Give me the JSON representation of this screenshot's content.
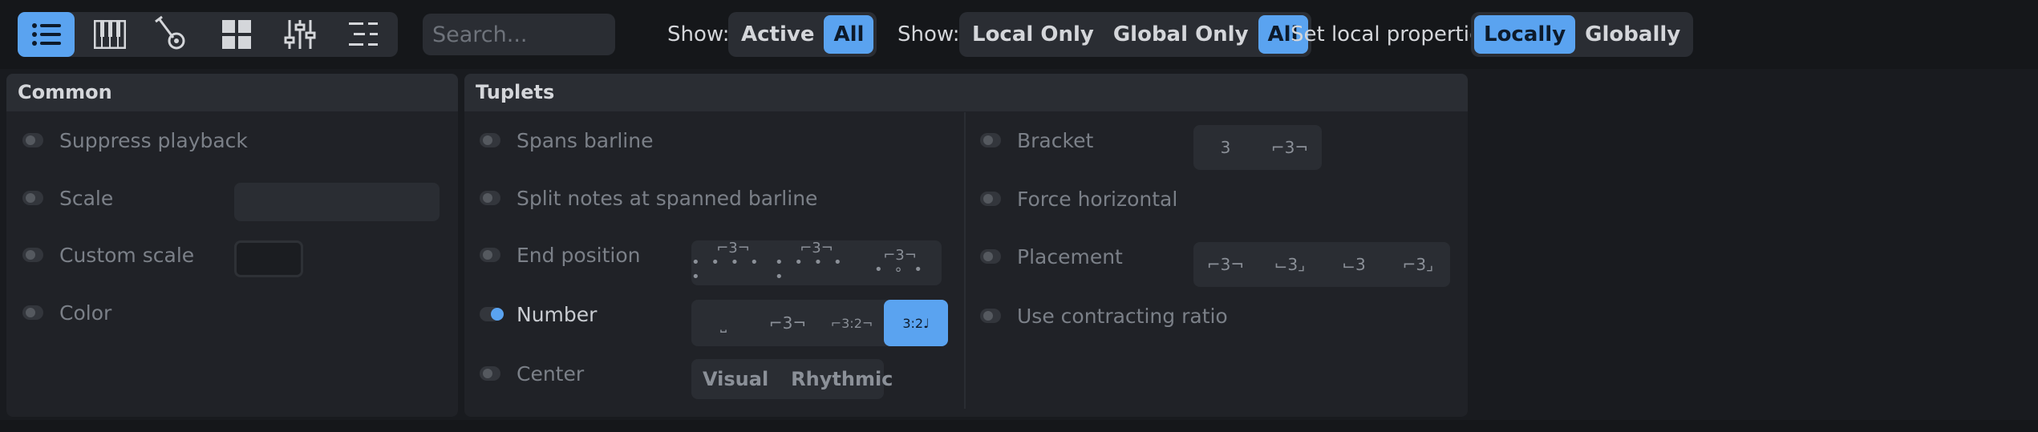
{
  "toolbar": {
    "icons": [
      "list-icon",
      "piano-icon",
      "guitar-icon",
      "grid-icon",
      "sliders-icon",
      "outline-icon"
    ],
    "search_placeholder": "Search...",
    "show1": {
      "label": "Show:",
      "options": [
        "Active",
        "All"
      ],
      "selected": "All"
    },
    "show2": {
      "label": "Show:",
      "options": [
        "Local Only",
        "Global Only",
        "All"
      ],
      "selected": "All"
    },
    "local": {
      "label": "Set local properties:",
      "options": [
        "Locally",
        "Globally"
      ],
      "selected": "Locally"
    }
  },
  "common": {
    "title": "Common",
    "rows": [
      "Suppress playback",
      "Scale",
      "Custom scale",
      "Color"
    ]
  },
  "tuplets": {
    "title": "Tuplets",
    "left_rows": [
      "Spans barline",
      "Split notes at spanned barline",
      "End position",
      "Number",
      "Center"
    ],
    "right_rows": [
      "Bracket",
      "Force horizontal",
      "Placement",
      "Use contracting ratio"
    ],
    "end_position_options": [
      "⌐3¬",
      "⌐3¬",
      "⌐3¬"
    ],
    "number_options": [
      "⎵",
      "⌐3¬",
      "⌐3:2¬",
      "3:2♩"
    ],
    "center_options": [
      "Visual",
      "Rhythmic"
    ],
    "bracket_options": [
      "3",
      "⌐3¬"
    ],
    "placement_options": [
      "⌐3¬",
      "⌙3⌟",
      "⌙3",
      "⌐3⌟"
    ]
  },
  "colors": {
    "accent": "#5aa3f0"
  }
}
